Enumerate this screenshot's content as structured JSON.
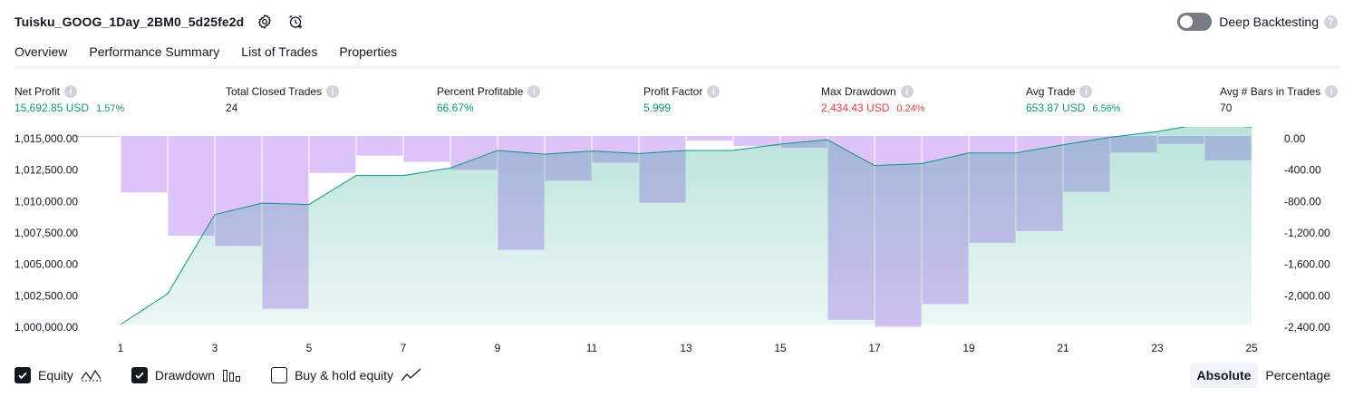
{
  "header": {
    "strategy_title": "Tuisku_GOOG_1Day_2BM0_5d25fe2d",
    "icons": [
      "gear-icon",
      "add-alert-icon"
    ],
    "deep_backtesting": {
      "label": "Deep Backtesting",
      "enabled": false
    }
  },
  "tabs": [
    {
      "label": "Overview",
      "active": true
    },
    {
      "label": "Performance Summary",
      "active": false
    },
    {
      "label": "List of Trades",
      "active": false
    },
    {
      "label": "Properties",
      "active": false
    }
  ],
  "metrics": [
    {
      "label": "Net Profit",
      "value": "15,692.85 USD",
      "pct": "1.57%",
      "color": "#089981"
    },
    {
      "label": "Total Closed Trades",
      "value": "24",
      "pct": "",
      "color": "#131722"
    },
    {
      "label": "Percent Profitable",
      "value": "66.67%",
      "pct": "",
      "color": "#089981"
    },
    {
      "label": "Profit Factor",
      "value": "5.999",
      "pct": "",
      "color": "#089981"
    },
    {
      "label": "Max Drawdown",
      "value": "2,434.43 USD",
      "pct": "0.24%",
      "color": "#f23645"
    },
    {
      "label": "Avg Trade",
      "value": "653.87 USD",
      "pct": "6.56%",
      "color": "#089981"
    },
    {
      "label": "Avg # Bars in Trades",
      "value": "70",
      "pct": "",
      "color": "#131722"
    }
  ],
  "chart_data": {
    "type": "area",
    "x": [
      1,
      2,
      3,
      4,
      5,
      6,
      7,
      8,
      9,
      10,
      11,
      12,
      13,
      14,
      15,
      16,
      17,
      18,
      19,
      20,
      21,
      22,
      23,
      24,
      25
    ],
    "x_tick_labels": [
      "1",
      "3",
      "5",
      "7",
      "9",
      "11",
      "13",
      "15",
      "17",
      "19",
      "21",
      "23",
      "25"
    ],
    "y_left_tick_labels": [
      "1,015,000.00",
      "1,012,500.00",
      "1,010,000.00",
      "1,007,500.00",
      "1,005,000.00",
      "1,002,500.00",
      "1,000,000.00"
    ],
    "y_left_range": [
      1000000,
      1015000
    ],
    "y_right_tick_labels": [
      "0.00",
      "-400.00",
      "-800.00",
      "-1,200.00",
      "-1,600.00",
      "-2,000.00",
      "-2,400.00"
    ],
    "y_right_range": [
      -2400,
      0
    ],
    "series": [
      {
        "name": "Equity",
        "kind": "area",
        "axis": "left",
        "color": "#089981",
        "values": [
          1000000,
          1002450,
          1008750,
          1009650,
          1009550,
          1011850,
          1011850,
          1012450,
          1013850,
          1013550,
          1013800,
          1013600,
          1013850,
          1013850,
          1014350,
          1014700,
          1012650,
          1012800,
          1013650,
          1013650,
          1014300,
          1014900,
          1015350,
          1016000,
          1015700
        ]
      },
      {
        "name": "Drawdown",
        "kind": "bar",
        "axis": "right",
        "color": "#ce93d8",
        "values": [
          -10,
          -720,
          -1270,
          -1400,
          -2200,
          -470,
          -250,
          -330,
          -430,
          -1450,
          -570,
          -340,
          -850,
          -60,
          -130,
          -150,
          -2340,
          -2430,
          -2140,
          -1360,
          -1210,
          -710,
          -210,
          -100,
          -310
        ]
      }
    ],
    "grid": false
  },
  "legend": {
    "items": [
      {
        "label": "Equity",
        "checked": true,
        "icon": "equity-line-icon"
      },
      {
        "label": "Drawdown",
        "checked": true,
        "icon": "drawdown-bars-icon"
      },
      {
        "label": "Buy & hold equity",
        "checked": false,
        "icon": "buy-hold-line-icon"
      }
    ],
    "modes": [
      {
        "label": "Absolute",
        "active": true
      },
      {
        "label": "Percentage",
        "active": false
      }
    ]
  }
}
